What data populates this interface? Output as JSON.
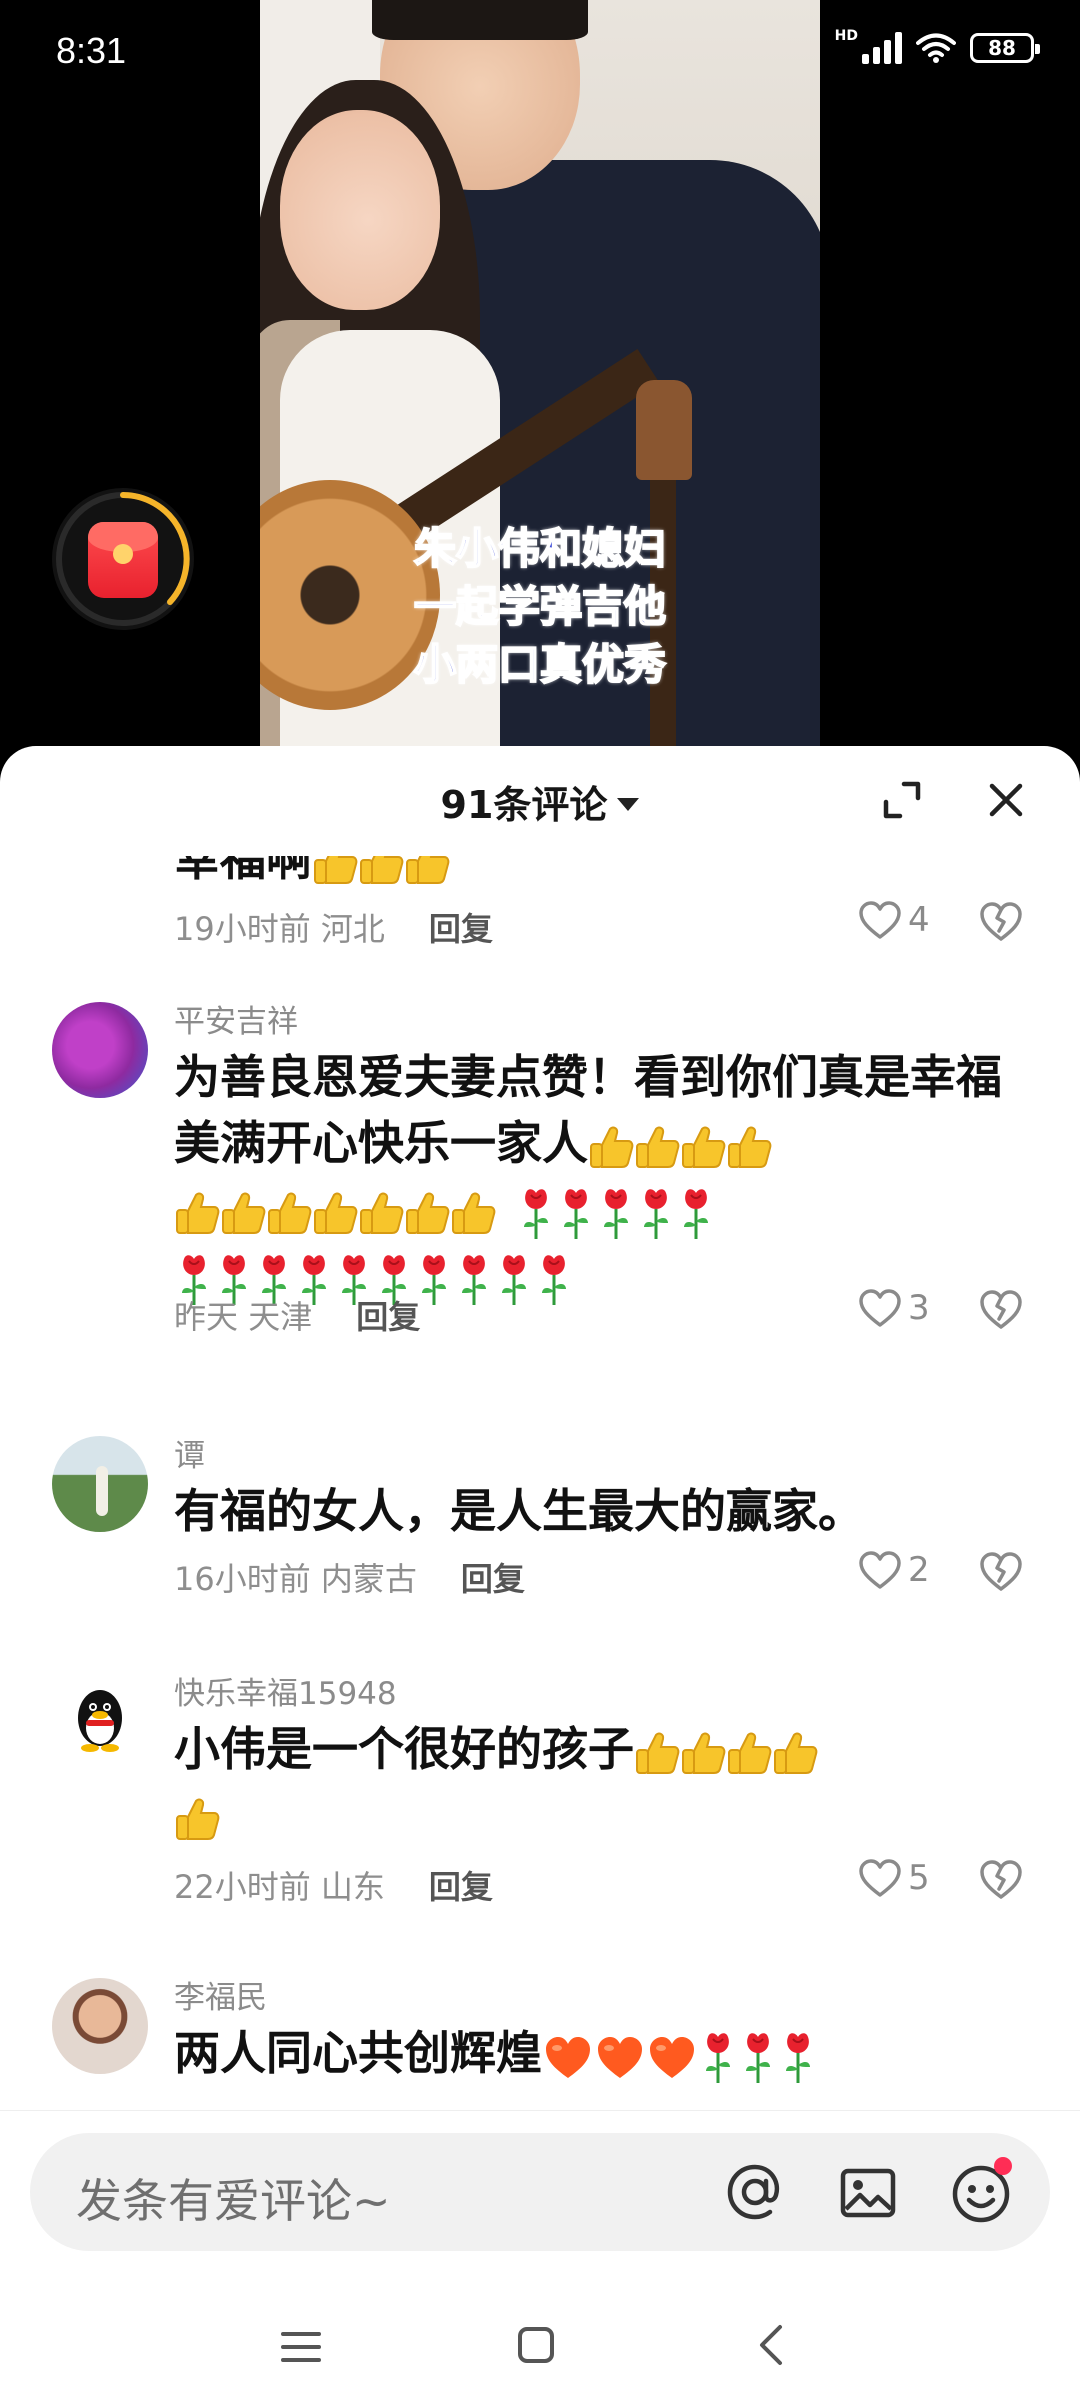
{
  "status_bar": {
    "time": "8:31",
    "network": "HD",
    "battery": "88"
  },
  "video": {
    "caption_lines": [
      "朱小伟和媳妇",
      "一起学弹吉他",
      "小两口真优秀"
    ]
  },
  "sheet": {
    "title": "91条评论",
    "expand_icon": "expand-icon",
    "close_icon": "close-icon"
  },
  "comments": [
    {
      "partial_text": "幸福啊",
      "time": "19小时前",
      "location": "河北",
      "reply_label": "回复",
      "likes": "4"
    },
    {
      "user": "平安吉祥",
      "text": "为善良恩爱夫妻点赞！看到你们真是幸福美满开心快乐一家人",
      "emoji": {
        "thumbs_up": 11,
        "rose": 15
      },
      "time": "昨天",
      "location": "天津",
      "reply_label": "回复",
      "likes": "3"
    },
    {
      "user": "谭",
      "text": "有福的女人，是人生最大的赢家。",
      "time": "16小时前",
      "location": "内蒙古",
      "reply_label": "回复",
      "likes": "2"
    },
    {
      "user": "快乐幸福15948",
      "text": "小伟是一个很好的孩子",
      "emoji": {
        "thumbs_up": 5
      },
      "time": "22小时前",
      "location": "山东",
      "reply_label": "回复",
      "likes": "5"
    },
    {
      "user": "李福民",
      "text": "两人同心共创辉煌",
      "emoji": {
        "heart": 3,
        "rose": 3
      }
    }
  ],
  "input": {
    "placeholder": "发条有爱评论~",
    "icons": [
      "at-icon",
      "image-icon",
      "emoji-icon"
    ]
  },
  "colors": {
    "like_gray": "#8a8a8a",
    "caption_blue": "#3a49d8",
    "badge_red": "#ff2d55",
    "redpacket_red": "#e8212e",
    "ring_yellow": "#f5b42a"
  }
}
